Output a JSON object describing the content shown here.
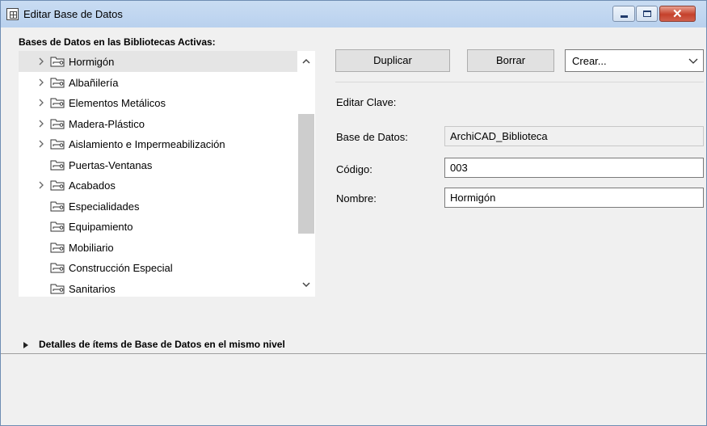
{
  "window": {
    "title": "Editar Base de Datos"
  },
  "library": {
    "label": "Bases de Datos en las Bibliotecas Activas:",
    "items": [
      {
        "label": "Hormigón",
        "expandable": true,
        "selected": true
      },
      {
        "label": "Albañilería",
        "expandable": true
      },
      {
        "label": "Elementos Metálicos",
        "expandable": true
      },
      {
        "label": "Madera-Plástico",
        "expandable": true
      },
      {
        "label": "Aislamiento e Impermeabilización",
        "expandable": true
      },
      {
        "label": "Puertas-Ventanas",
        "expandable": false
      },
      {
        "label": "Acabados",
        "expandable": true
      },
      {
        "label": "Especialidades",
        "expandable": false
      },
      {
        "label": "Equipamiento",
        "expandable": false
      },
      {
        "label": "Mobiliario",
        "expandable": false
      },
      {
        "label": "Construcción Especial",
        "expandable": false
      },
      {
        "label": "Sanitarios",
        "expandable": false
      }
    ]
  },
  "toolbar": {
    "duplicate_label": "Duplicar",
    "delete_label": "Borrar",
    "create_selected": "Crear..."
  },
  "edit": {
    "heading": "Editar Clave:",
    "database_label": "Base de Datos:",
    "database_value": "ArchiCAD_Biblioteca",
    "code_label": "Código:",
    "code_value": "003",
    "name_label": "Nombre:",
    "name_value": "Hormigón"
  },
  "details": {
    "label": "Detalles de ítems de Base de Datos en el mismo nivel"
  },
  "colors": {
    "titlebar": "#c9dcf2",
    "close_button": "#c5412b",
    "selection": "#e5e5e5"
  }
}
